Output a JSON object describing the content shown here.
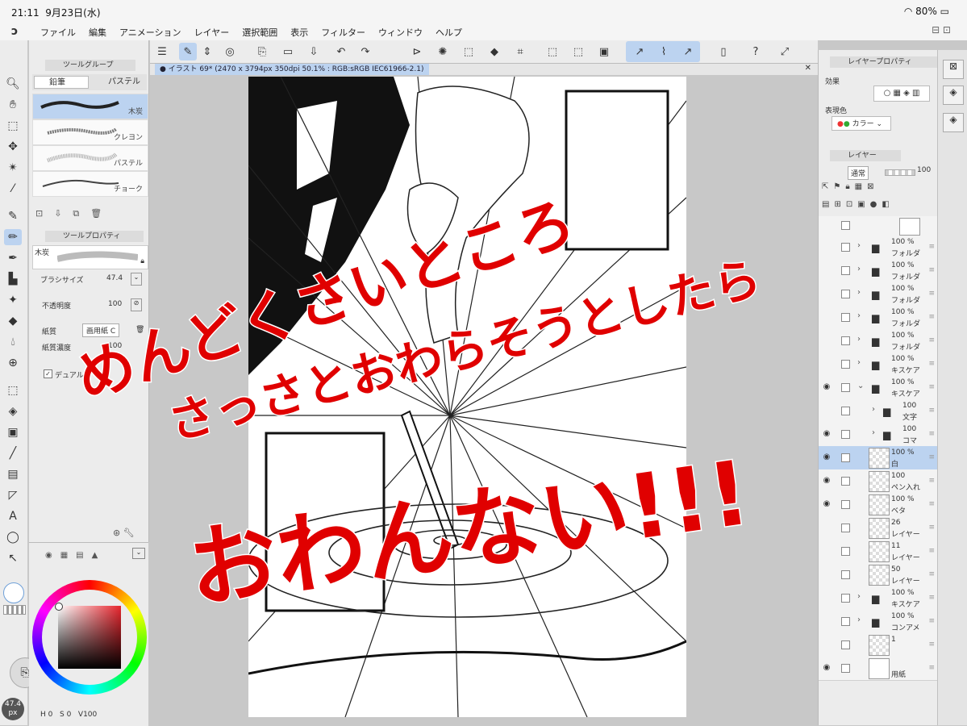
{
  "status": {
    "time": "21:11",
    "date": "9月23日(水)",
    "battery": "80%"
  },
  "menu": {
    "items": [
      "ファイル",
      "編集",
      "アニメーション",
      "レイヤー",
      "選択範囲",
      "表示",
      "フィルター",
      "ウィンドウ",
      "ヘルプ"
    ]
  },
  "subtool": {
    "group_tab": "ツールグループ",
    "tabs": [
      "鉛筆",
      "パステル"
    ],
    "brushes": [
      "木炭",
      "クレヨン",
      "パステル",
      "チョーク"
    ],
    "prop_tab": "ツールプロパティ",
    "prop_brush_name": "木炭",
    "brush_size_label": "ブラシサイズ",
    "brush_size_value": "47.4",
    "opacity_label": "不透明度",
    "opacity_value": "100",
    "paper_label": "紙質",
    "paper_value": "画用紙 C",
    "paper_density_label": "紙質濃度",
    "paper_density_value": "100",
    "dual_label": "デュアル"
  },
  "color": {
    "main_hex": "#ffffff",
    "hue_hex": "#e8262e"
  },
  "bottom": {
    "size_badge": "47.4",
    "size_unit": "px",
    "h": "H",
    "h_val": "0",
    "s": "S",
    "s_val": "0",
    "v": "V",
    "v_val": "100"
  },
  "canvas": {
    "tab_title": "イラスト 69* (2470 x 3794px 350dpi 50.1% : RGB:sRGB IEC61966-2.1)"
  },
  "layer_property": {
    "title": "レイヤープロパティ",
    "effect_label": "効果",
    "color_label": "表現色",
    "color_value": "カラー"
  },
  "layers_panel": {
    "title": "レイヤー",
    "blend_mode": "通常",
    "opacity": "100",
    "rows": [
      {
        "type": "folder",
        "pct": "100 %",
        "name": "フォルダ",
        "visible": false
      },
      {
        "type": "folder",
        "pct": "100 %",
        "name": "フォルダ",
        "visible": false
      },
      {
        "type": "folder",
        "pct": "100 %",
        "name": "フォルダ",
        "visible": false
      },
      {
        "type": "folder",
        "pct": "100 %",
        "name": "フォルダ",
        "visible": false
      },
      {
        "type": "folder",
        "pct": "100 %",
        "name": "フォルダ",
        "visible": false
      },
      {
        "type": "folder",
        "pct": "100 %",
        "name": "キスケア",
        "visible": false
      },
      {
        "type": "folder-open",
        "pct": "100 %",
        "name": "キスケア",
        "visible": true
      },
      {
        "type": "subfolder",
        "pct": "100",
        "name": "文字",
        "visible": false
      },
      {
        "type": "subfolder",
        "pct": "100",
        "name": "コマ",
        "visible": true
      },
      {
        "type": "layer",
        "pct": "100 %",
        "name": "白",
        "visible": true,
        "selected": true
      },
      {
        "type": "layer",
        "pct": "100",
        "name": "ペン入れ",
        "visible": true
      },
      {
        "type": "layer",
        "pct": "100 %",
        "name": "ベタ",
        "visible": true
      },
      {
        "type": "layer",
        "pct": "26",
        "name": "レイヤー",
        "visible": false
      },
      {
        "type": "layer",
        "pct": "11",
        "name": "レイヤー",
        "visible": false
      },
      {
        "type": "layer",
        "pct": "50",
        "name": "レイヤー",
        "visible": false
      },
      {
        "type": "folder",
        "pct": "100 %",
        "name": "キスケア",
        "visible": false
      },
      {
        "type": "folder",
        "pct": "100 %",
        "name": "コンアメ",
        "visible": false
      },
      {
        "type": "layer",
        "pct": "1",
        "name": "",
        "visible": false
      },
      {
        "type": "paper",
        "pct": "",
        "name": "用紙",
        "visible": true
      }
    ]
  },
  "handwriting": {
    "line1": "めんどくさいところ",
    "line2": "さっさとおわらそうとしたら",
    "line3": "おわんない!!!"
  }
}
